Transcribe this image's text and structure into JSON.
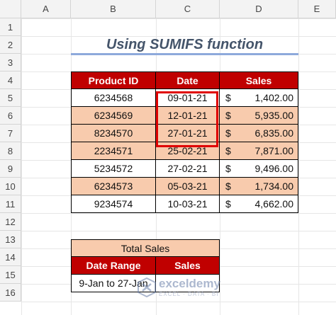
{
  "columns": [
    "A",
    "B",
    "C",
    "D",
    "E"
  ],
  "rows": [
    "1",
    "2",
    "3",
    "4",
    "5",
    "6",
    "7",
    "8",
    "9",
    "10",
    "11",
    "12",
    "13",
    "14",
    "15",
    "16"
  ],
  "title": "Using SUMIFS function",
  "table": {
    "headers": [
      "Product ID",
      "Date",
      "Sales"
    ],
    "rows": [
      {
        "id": "6234568",
        "date": "09-01-21",
        "currency": "$",
        "sales": "1,402.00"
      },
      {
        "id": "6234569",
        "date": "12-01-21",
        "currency": "$",
        "sales": "5,935.00"
      },
      {
        "id": "8234570",
        "date": "27-01-21",
        "currency": "$",
        "sales": "6,835.00"
      },
      {
        "id": "2234571",
        "date": "25-02-21",
        "currency": "$",
        "sales": "7,871.00"
      },
      {
        "id": "5234572",
        "date": "27-02-21",
        "currency": "$",
        "sales": "9,496.00"
      },
      {
        "id": "6234573",
        "date": "05-03-21",
        "currency": "$",
        "sales": "1,734.00"
      },
      {
        "id": "9234574",
        "date": "10-03-21",
        "currency": "$",
        "sales": "4,662.00"
      }
    ]
  },
  "summary": {
    "title": "Total Sales",
    "headers": [
      "Date Range",
      "Sales"
    ],
    "range": "9-Jan to 27-Jan",
    "sales": ""
  },
  "watermark": {
    "name": "exceldemy",
    "tagline": "EXCEL · DATA · BI"
  },
  "colors": {
    "header": "#c00000",
    "band": "#f8cbad",
    "highlight": "#e00000",
    "title": "#44546a"
  }
}
